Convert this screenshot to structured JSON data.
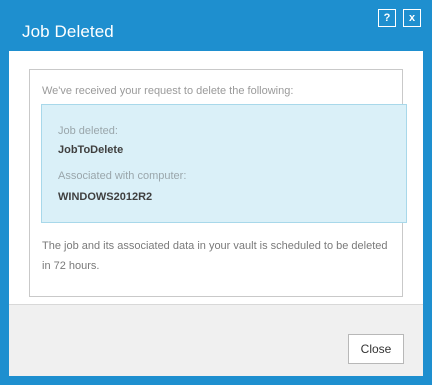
{
  "dialog": {
    "title": "Job Deleted",
    "help_label": "?",
    "close_label": "x"
  },
  "content": {
    "intro": "We've received your request to delete the following:",
    "job_label": "Job deleted:",
    "job_value": "JobToDelete",
    "computer_label": "Associated with computer:",
    "computer_value": "WINDOWS2012R2",
    "note": "The job and its associated data in your vault is scheduled to be deleted in 72 hours."
  },
  "footer": {
    "close_button": "Close"
  },
  "colors": {
    "accent": "#1e8fcf",
    "info_background": "#daf0f8",
    "info_border": "#a8d8ea"
  },
  "icons": {
    "help": "help-icon",
    "close": "close-icon"
  }
}
